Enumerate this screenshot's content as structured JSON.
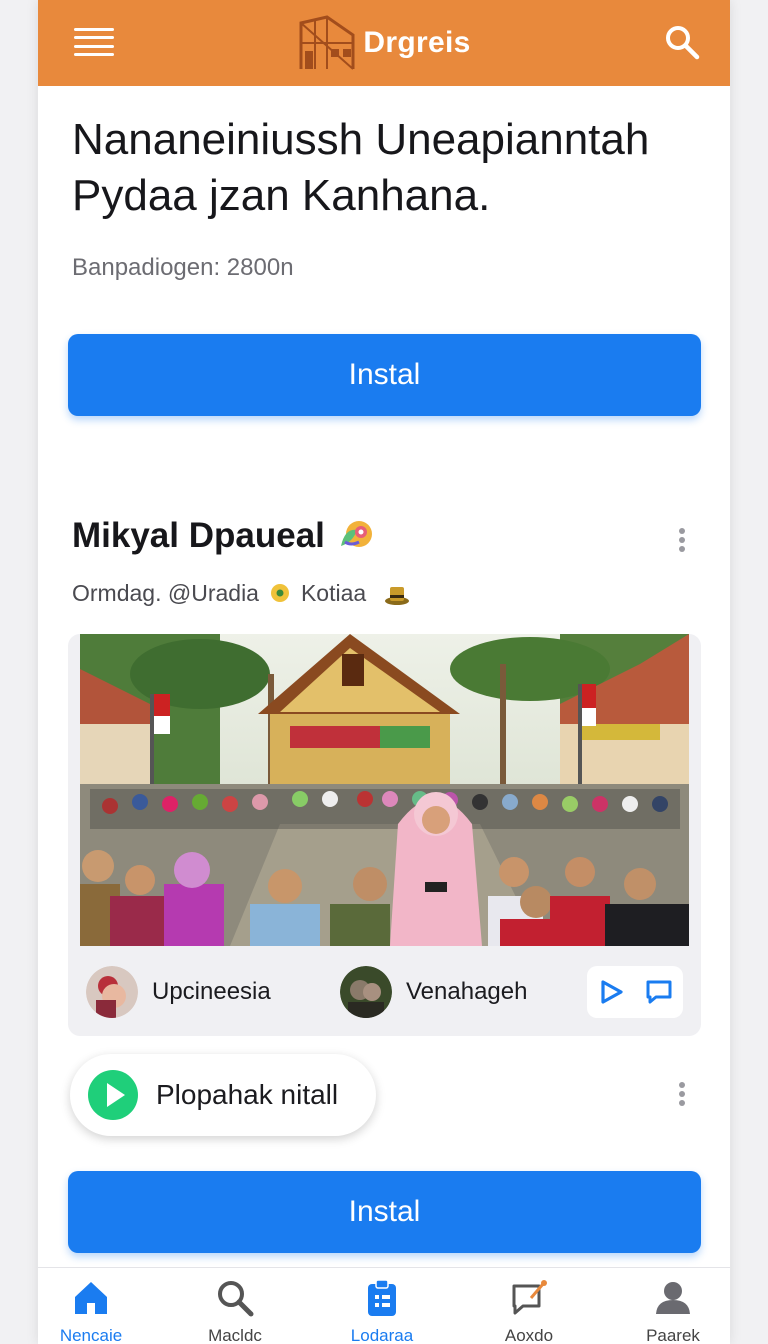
{
  "app": {
    "brand": "Drgreis",
    "accent_color": "#e8893c",
    "primary_color": "#1a7cf0",
    "menu_icon": "hamburger-menu-icon",
    "search_icon": "search-icon"
  },
  "hero": {
    "title": "Nananeiniussh Uneapianntah Pydaa jzan Kanhana.",
    "subtitle": "Banpadiogen: 2800n",
    "install_label": "Instal"
  },
  "post": {
    "title": "Mikyal Dpaueal",
    "meta_left": "Ormdag. @Uradia",
    "meta_right": "Kotiaa",
    "chips": [
      {
        "label": "Upcineesia"
      },
      {
        "label": "Venahageh"
      }
    ],
    "play_label": "Plopahak nitall",
    "install_label": "Instal"
  },
  "bottom_nav": [
    {
      "label": "Nencaie",
      "icon": "home-icon",
      "active": true
    },
    {
      "label": "Macldc",
      "icon": "search-icon",
      "active": false
    },
    {
      "label": "Lodaraa",
      "icon": "clipboard-icon",
      "active": true
    },
    {
      "label": "Aoxdo",
      "icon": "edit-chat-icon",
      "active": false
    },
    {
      "label": "Paarek",
      "icon": "profile-icon",
      "active": false
    }
  ]
}
